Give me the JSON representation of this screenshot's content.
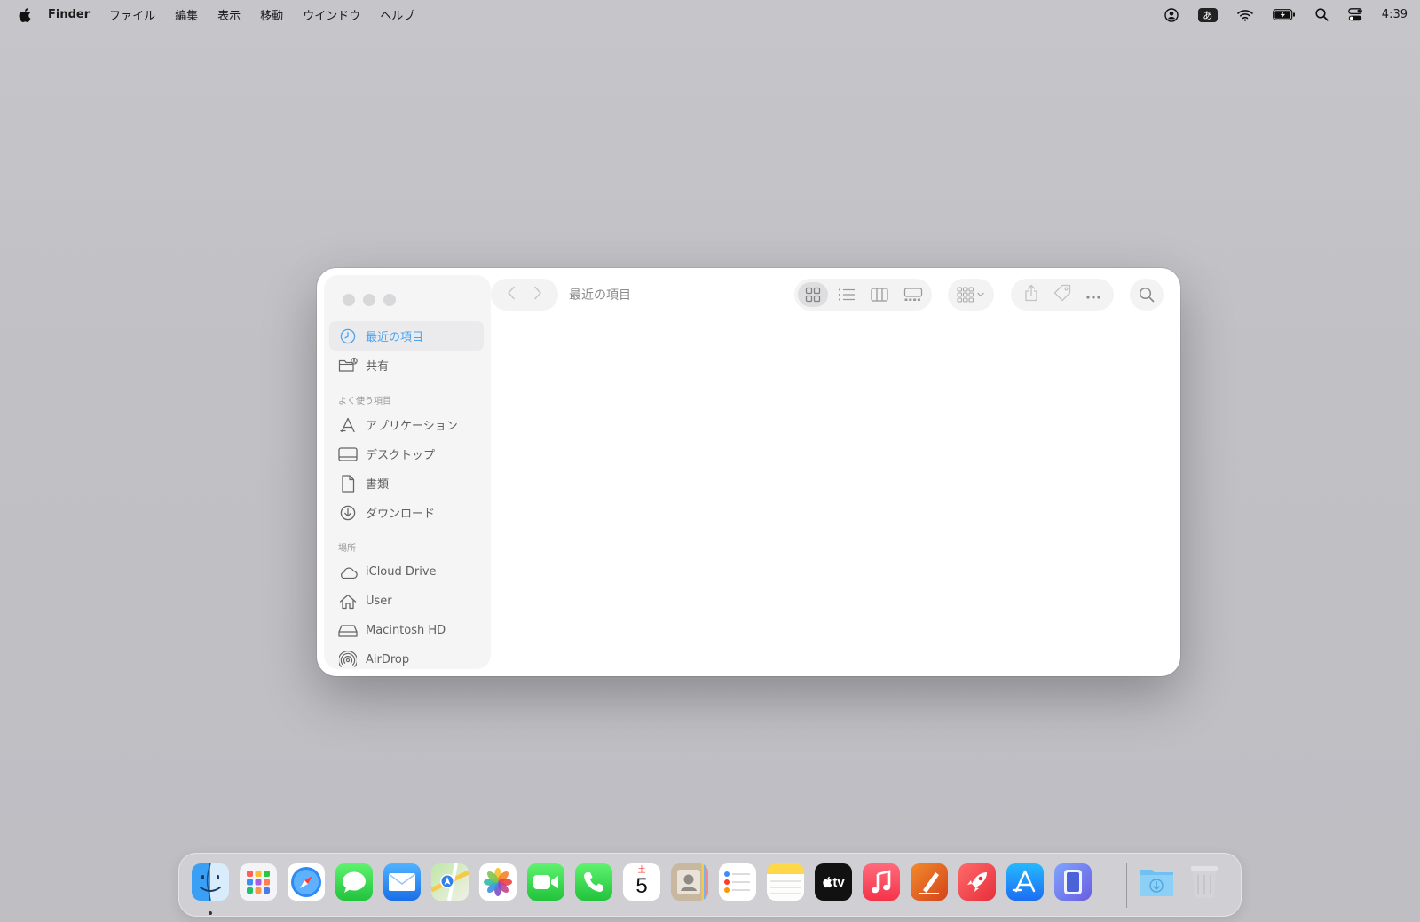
{
  "menubar": {
    "app_name": "Finder",
    "items": [
      "ファイル",
      "編集",
      "表示",
      "移動",
      "ウインドウ",
      "ヘルプ"
    ],
    "ime": "あ",
    "clock": "4:39",
    "status_icons": [
      "user-icon",
      "input-method-icon",
      "wifi-icon",
      "battery-icon",
      "spotlight-icon",
      "control-center-icon"
    ]
  },
  "window": {
    "title": "最近の項目",
    "sidebar": {
      "top_items": [
        {
          "label": "最近の項目",
          "icon": "clock-icon",
          "active": true
        },
        {
          "label": "共有",
          "icon": "shared-folder-icon",
          "active": false
        }
      ],
      "favorites_heading": "よく使う項目",
      "favorites": [
        {
          "label": "アプリケーション",
          "icon": "applications-icon"
        },
        {
          "label": "デスクトップ",
          "icon": "desktop-icon"
        },
        {
          "label": "書類",
          "icon": "document-icon"
        },
        {
          "label": "ダウンロード",
          "icon": "download-icon"
        }
      ],
      "locations_heading": "場所",
      "locations": [
        {
          "label": "iCloud Drive",
          "icon": "cloud-icon"
        },
        {
          "label": "User",
          "icon": "home-icon"
        },
        {
          "label": "Macintosh HD",
          "icon": "disk-icon"
        },
        {
          "label": "AirDrop",
          "icon": "airdrop-icon"
        }
      ]
    },
    "active_view": "icon",
    "accent": "#4aa3f0"
  },
  "dock": {
    "apps": [
      "Finder",
      "Launchpad",
      "Safari",
      "Messages",
      "Mail",
      "Maps",
      "Photos",
      "FaceTime",
      "Phone",
      "Calendar",
      "Contacts",
      "Reminders",
      "Notes",
      "TV",
      "Music",
      "Pages",
      "Rocket",
      "App Store",
      "iPhone Mirroring"
    ],
    "calendar_day": "5",
    "calendar_weekday": "土",
    "tv_label": "tv",
    "running": [
      "Finder"
    ],
    "right_items": [
      "Downloads",
      "Trash"
    ]
  }
}
